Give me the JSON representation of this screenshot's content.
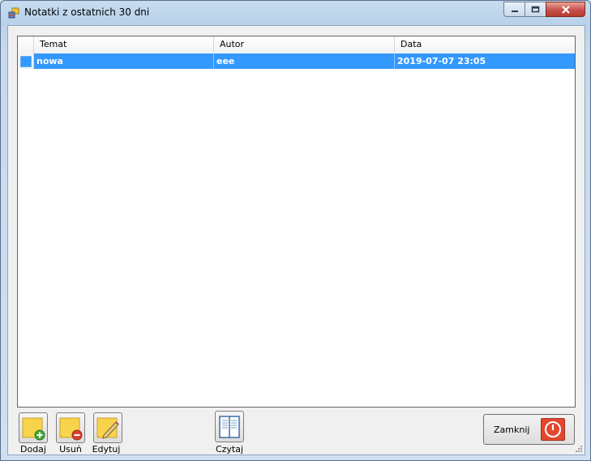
{
  "window": {
    "title": "Notatki z ostatnich 30 dni"
  },
  "grid": {
    "columns": [
      "Temat",
      "Autor",
      "Data"
    ],
    "rows": [
      {
        "temat": "nowa",
        "autor": "eee",
        "data": "2019-07-07 23:05",
        "selected": true
      }
    ]
  },
  "toolbar": {
    "add_label": "Dodaj",
    "delete_label": "Usuń",
    "edit_label": "Edytuj",
    "read_label": "Czytaj"
  },
  "close_button": {
    "label": "Zamknij"
  },
  "colors": {
    "selection": "#3399ff",
    "close_accent": "#e2482d",
    "note_yellow": "#f8d44c"
  }
}
